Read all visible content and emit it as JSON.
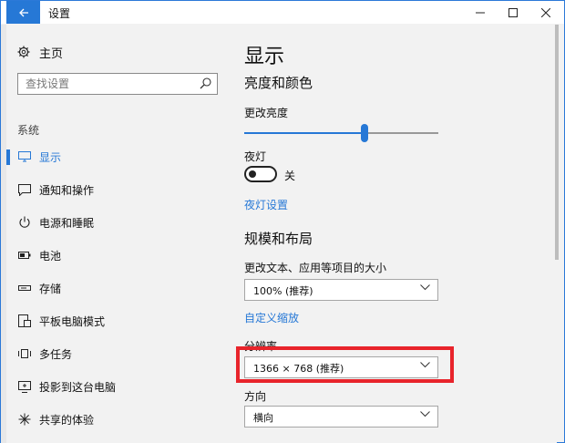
{
  "window": {
    "title": "设置",
    "accent": "#2678d6",
    "highlight_color": "#e8242b"
  },
  "sidebar": {
    "home_label": "主页",
    "search": {
      "placeholder": "查找设置",
      "value": ""
    },
    "section_label": "系统",
    "items": [
      {
        "label": "显示",
        "icon": "monitor-icon",
        "active": true
      },
      {
        "label": "通知和操作",
        "icon": "notification-icon",
        "active": false
      },
      {
        "label": "电源和睡眠",
        "icon": "power-icon",
        "active": false
      },
      {
        "label": "电池",
        "icon": "battery-icon",
        "active": false
      },
      {
        "label": "存储",
        "icon": "storage-icon",
        "active": false
      },
      {
        "label": "平板电脑模式",
        "icon": "tablet-mode-icon",
        "active": false
      },
      {
        "label": "多任务",
        "icon": "multitask-icon",
        "active": false
      },
      {
        "label": "投影到这台电脑",
        "icon": "project-icon",
        "active": false
      },
      {
        "label": "共享的体验",
        "icon": "shared-experience-icon",
        "active": false
      }
    ]
  },
  "main": {
    "title": "显示",
    "brightness_section": "亮度和颜色",
    "brightness_label": "更改亮度",
    "brightness_level": 0.62,
    "night_light_label": "夜灯",
    "night_light_state": "关",
    "night_light_settings_link": "夜灯设置",
    "scale_section": "规模和布局",
    "scale_label": "更改文本、应用等项目的大小",
    "scale_value": "100% (推荐)",
    "custom_scale_link": "自定义缩放",
    "resolution_label": "分辨率",
    "resolution_value": "1366 × 768 (推荐)",
    "orientation_label": "方向",
    "orientation_value": "横向"
  }
}
